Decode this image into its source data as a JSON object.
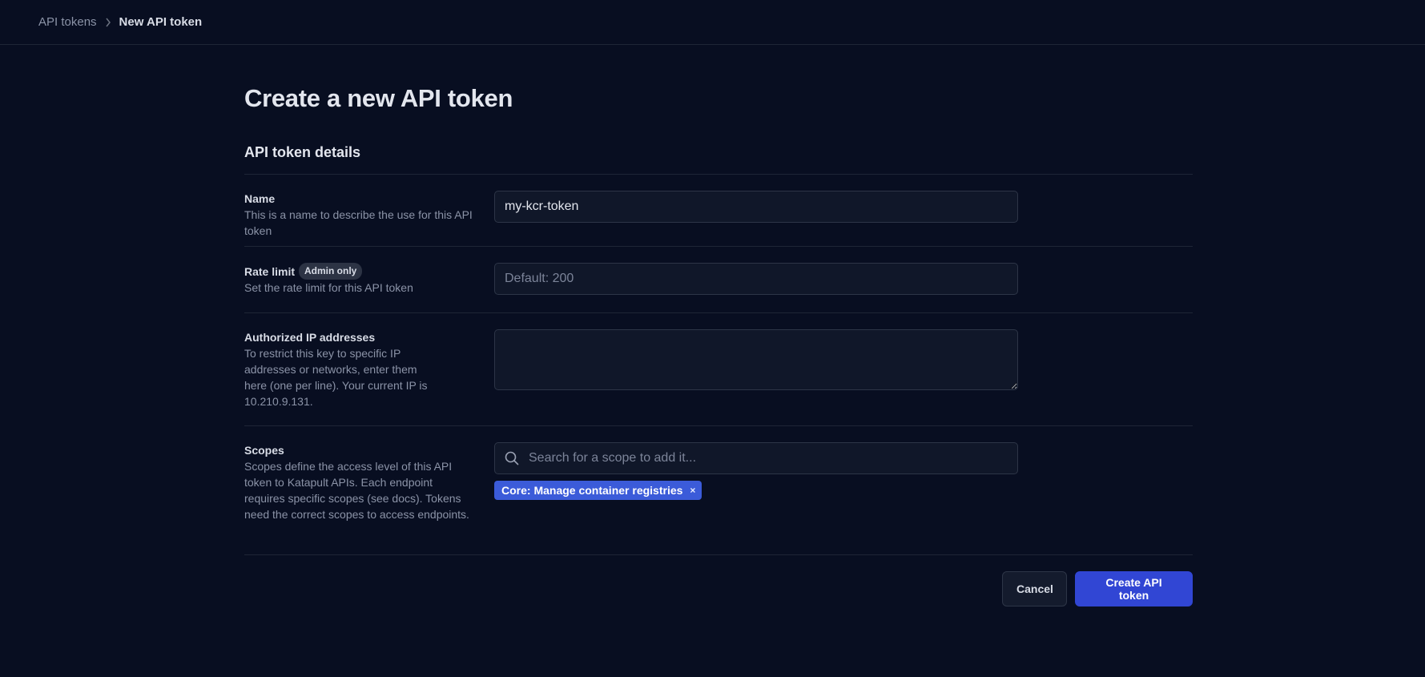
{
  "breadcrumb": {
    "parent": "API tokens",
    "current": "New API token"
  },
  "page": {
    "title": "Create a new API token",
    "section_title": "API token details"
  },
  "fields": {
    "name": {
      "label": "Name",
      "description": "This is a name to describe the use for this API token",
      "value": "my-kcr-token"
    },
    "rate_limit": {
      "label": "Rate limit",
      "badge": "Admin only",
      "description": "Set the rate limit for this API token",
      "placeholder": "Default: 200"
    },
    "ips": {
      "label": "Authorized IP addresses",
      "description": "To restrict this key to specific IP addresses or networks, enter them here (one per line). Your current IP is 10.210.9.131."
    },
    "scopes": {
      "label": "Scopes",
      "description": "Scopes define the access level of this API token to Katapult APIs. Each endpoint requires specific scopes (see docs). Tokens need the correct scopes to access endpoints.",
      "placeholder": "Search for a scope to add it...",
      "selected": [
        "Core: Manage container registries"
      ],
      "remove_glyph": "×"
    }
  },
  "actions": {
    "cancel": "Cancel",
    "create": "Create API token"
  },
  "colors": {
    "background": "#080e21",
    "chip": "#3b5bd9",
    "primary_button": "#3146d4"
  }
}
